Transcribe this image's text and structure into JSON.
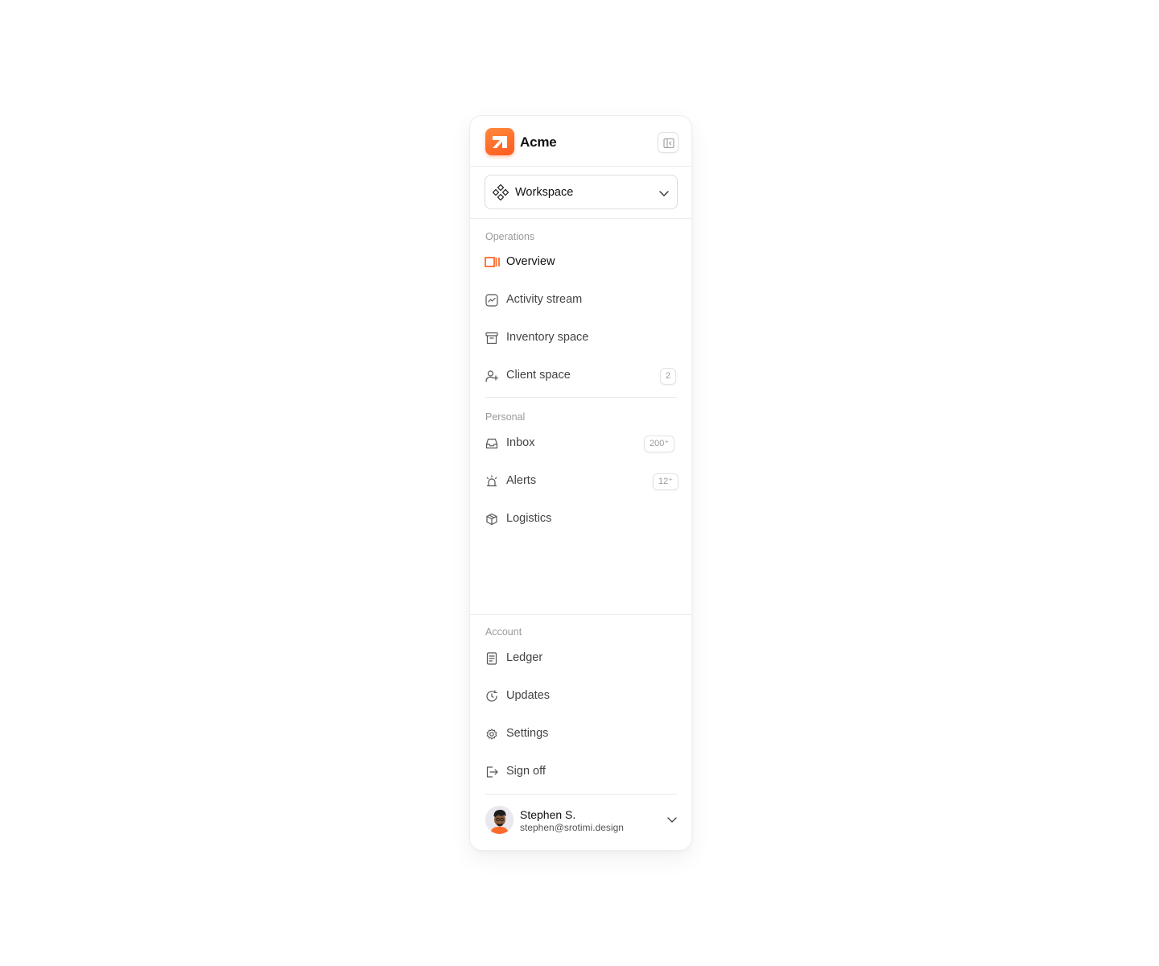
{
  "app": {
    "brand": "Acme",
    "accent_color": "#ff6a2b",
    "logo_icon": "acme-logo",
    "collapse_icon": "sidebar-collapse-icon"
  },
  "workspace": {
    "label": "Workspace",
    "icon": "workspace-diamond-icon"
  },
  "sections": {
    "operations": {
      "label": "Operations",
      "items": [
        {
          "label": "Overview",
          "icon": "overview-icon",
          "active": true
        },
        {
          "label": "Activity stream",
          "icon": "activity-chart-icon"
        },
        {
          "label": "Inventory space",
          "icon": "archive-box-icon"
        },
        {
          "label": "Client space",
          "icon": "user-add-icon",
          "badge": "2"
        }
      ]
    },
    "personal": {
      "label": "Personal",
      "items": [
        {
          "label": "Inbox",
          "icon": "inbox-icon",
          "badge": "200⁺"
        },
        {
          "label": "Alerts",
          "icon": "alarm-light-icon",
          "badge": "12⁺"
        },
        {
          "label": "Logistics",
          "icon": "package-icon"
        }
      ]
    },
    "account": {
      "label": "Account",
      "items": [
        {
          "label": "Ledger",
          "icon": "ledger-receipt-icon"
        },
        {
          "label": "Updates",
          "icon": "refresh-clock-icon"
        },
        {
          "label": "Settings",
          "icon": "gear-icon"
        },
        {
          "label": "Sign off",
          "icon": "logout-icon"
        }
      ]
    }
  },
  "user": {
    "name": "Stephen S.",
    "email": "stephen@srotimi.design"
  }
}
